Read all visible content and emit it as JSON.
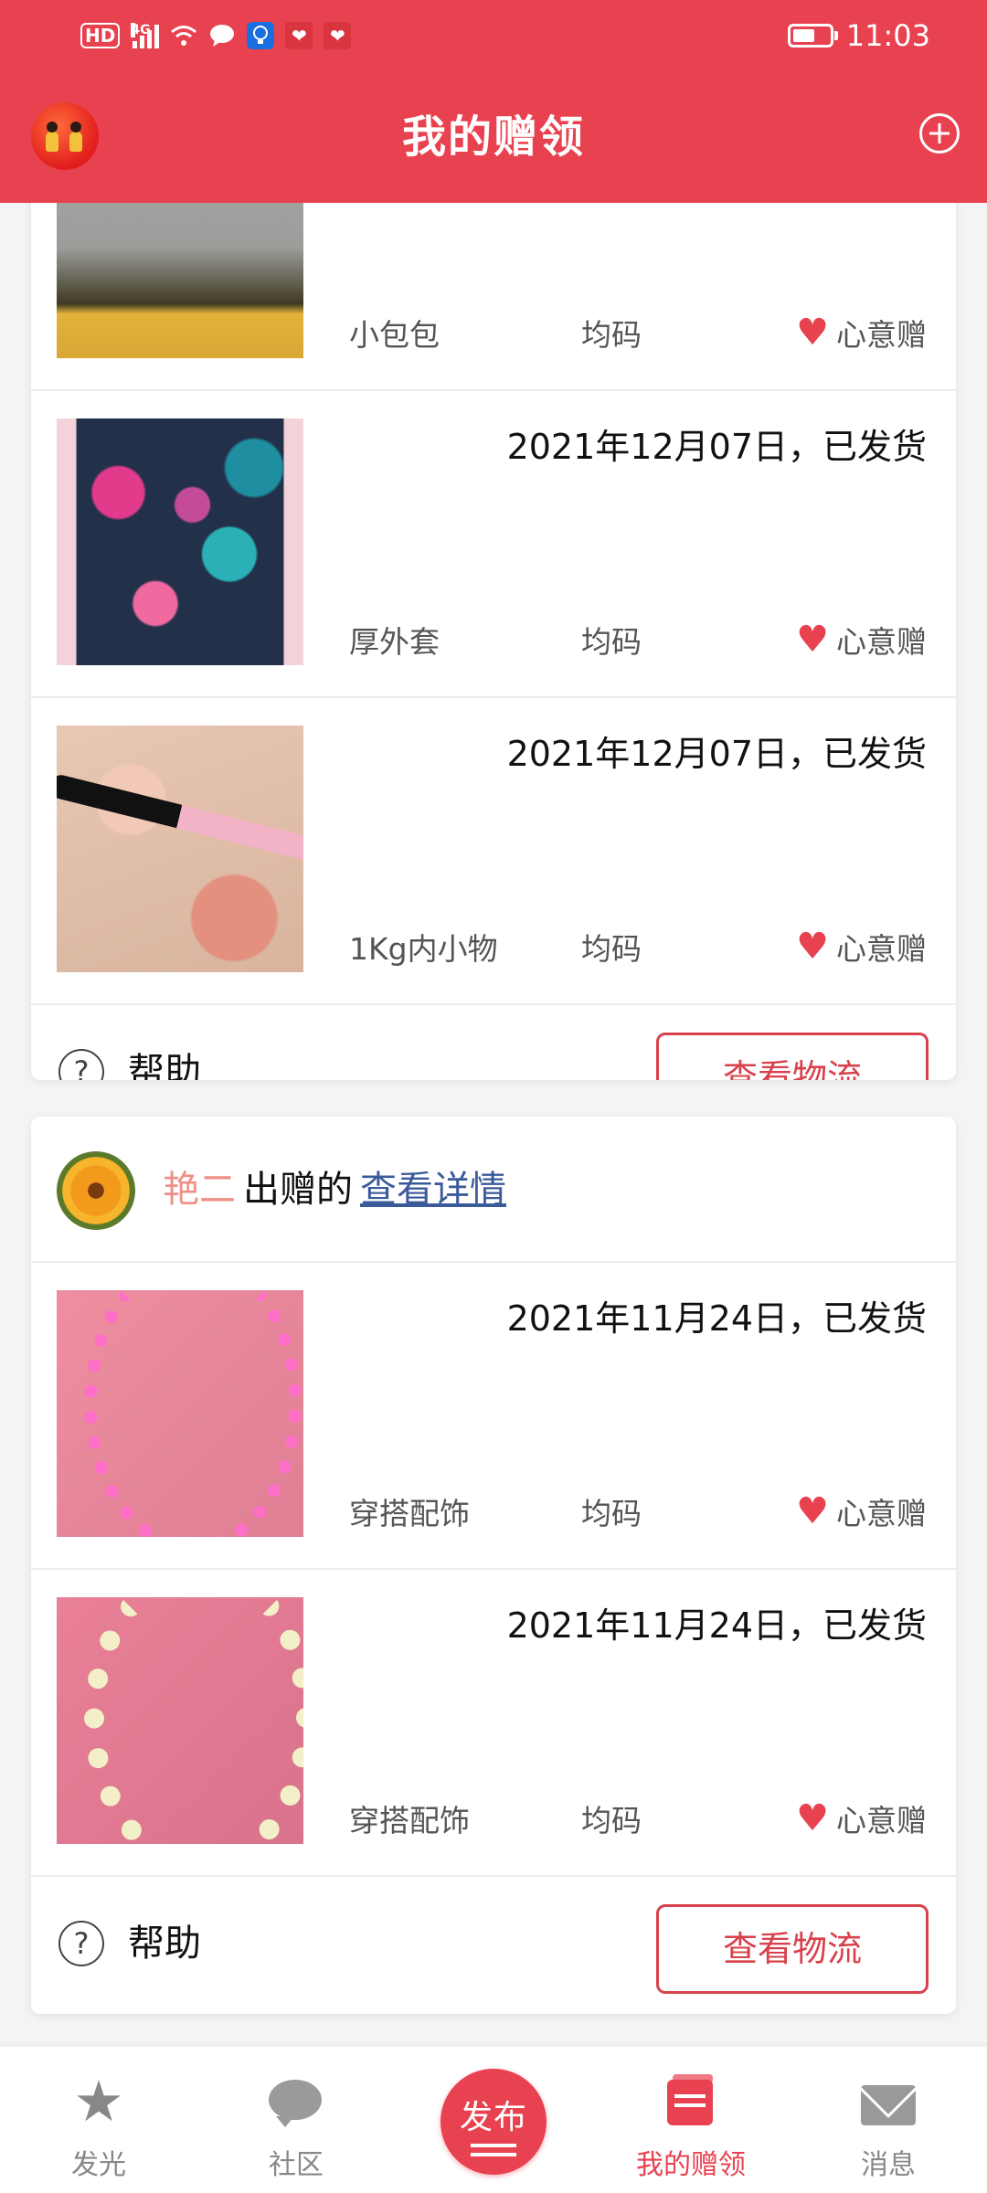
{
  "status_bar": {
    "hd": "HD",
    "network": "4G",
    "time": "11:03",
    "battery_level": 0.6
  },
  "header": {
    "title": "我的赠领"
  },
  "card1": {
    "items": [
      {
        "name": "小包包",
        "size": "均码",
        "tag": "心意赠",
        "date": ""
      },
      {
        "name": "厚外套",
        "size": "均码",
        "tag": "心意赠",
        "date": "2021年12月07日，已发货"
      },
      {
        "name": "1Kg内小物",
        "size": "均码",
        "tag": "心意赠",
        "date": "2021年12月07日，已发货"
      }
    ],
    "help_label": "帮助",
    "logistics_label": "查看物流"
  },
  "card2": {
    "donor_name": "艳二",
    "donor_text": "出赠的",
    "detail_link": "查看详情",
    "items": [
      {
        "name": "穿搭配饰",
        "size": "均码",
        "tag": "心意赠",
        "date": "2021年11月24日，已发货"
      },
      {
        "name": "穿搭配饰",
        "size": "均码",
        "tag": "心意赠",
        "date": "2021年11月24日，已发货"
      }
    ],
    "help_label": "帮助",
    "logistics_label": "查看物流"
  },
  "bottom_nav": {
    "items": [
      {
        "label": "发光",
        "icon": "star-icon"
      },
      {
        "label": "社区",
        "icon": "chat-bubble-icon"
      },
      {
        "label": "发布",
        "icon": "publish-icon"
      },
      {
        "label": "我的赠领",
        "icon": "gift-books-icon",
        "active": true
      },
      {
        "label": "消息",
        "icon": "mail-icon"
      }
    ]
  },
  "colors": {
    "brand": "#e8414f",
    "donor_name": "#f08f86",
    "link": "#3b5a9a"
  }
}
